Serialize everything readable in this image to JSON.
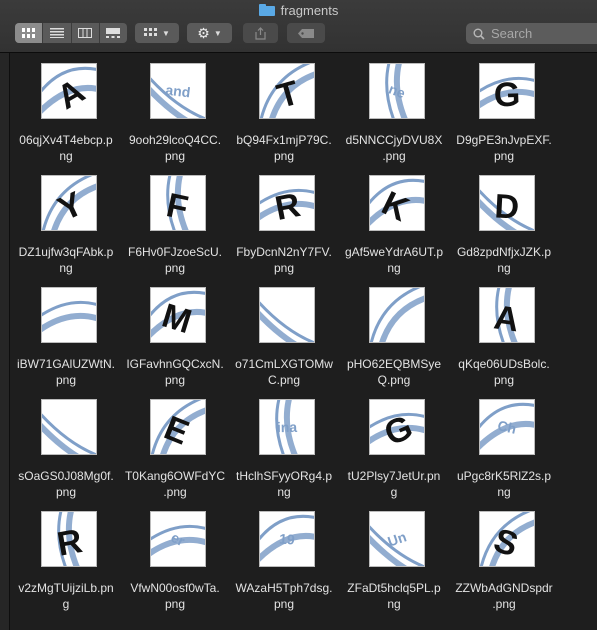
{
  "window": {
    "title": "fragments"
  },
  "toolbar": {
    "view_icons": [
      "icon-view-icon",
      "list-view-icon",
      "column-view-icon",
      "gallery-view-icon"
    ],
    "search_placeholder": "Search"
  },
  "files": [
    {
      "line1": "06qjXv4T4ebcp.p",
      "line2": "ng",
      "glyph": "A"
    },
    {
      "line1": "9ooh29lcoQ4CC.",
      "line2": "png",
      "glyph": "and"
    },
    {
      "line1": "bQ94Fx1mjP79C.",
      "line2": "png",
      "glyph": "T"
    },
    {
      "line1": "d5NNCCjyDVU8X",
      "line2": ".png",
      "glyph": "ne"
    },
    {
      "line1": "D9gPE3nJvpEXF.",
      "line2": "png",
      "glyph": "G"
    },
    {
      "line1": "DZ1ujfw3qFAbk.p",
      "line2": "ng",
      "glyph": "Y"
    },
    {
      "line1": "F6Hv0FJzoeScU.",
      "line2": "png",
      "glyph": "F"
    },
    {
      "line1": "FbyDcnN2nY7FV.",
      "line2": "png",
      "glyph": "R"
    },
    {
      "line1": "gAf5weYdrA6UT.p",
      "line2": "ng",
      "glyph": "K"
    },
    {
      "line1": "Gd8zpdNfjxJZK.p",
      "line2": "ng",
      "glyph": "D"
    },
    {
      "line1": "iBW71GAlUZWtN.",
      "line2": "png",
      "glyph": ""
    },
    {
      "line1": "IGFavhnGQCxcN.",
      "line2": "png",
      "glyph": "M"
    },
    {
      "line1": "o71CmLXGTOMw",
      "line2": "C.png",
      "glyph": ""
    },
    {
      "line1": "pHO62EQBMSye",
      "line2": "Q.png",
      "glyph": ""
    },
    {
      "line1": "qKqe06UDsBolc.",
      "line2": "png",
      "glyph": "A"
    },
    {
      "line1": "sOaGS0J08Mg0f.",
      "line2": "png",
      "glyph": ""
    },
    {
      "line1": "T0Kang6OWFdYC",
      "line2": ".png",
      "glyph": "E"
    },
    {
      "line1": "tHclhSFyyORg4.p",
      "line2": "ng",
      "glyph": "ina"
    },
    {
      "line1": "tU2Plsy7JetUr.pn",
      "line2": "g",
      "glyph": "G"
    },
    {
      "line1": "uPgc8rK5RlZ2s.p",
      "line2": "ng",
      "glyph": "Ch"
    },
    {
      "line1": "v2zMgTUijziLb.pn",
      "line2": "g",
      "glyph": "R"
    },
    {
      "line1": "VfwN00osf0wTa.",
      "line2": "png",
      "glyph": "er"
    },
    {
      "line1": "WAzaH5Tph7dsg.",
      "line2": "png",
      "glyph": "19"
    },
    {
      "line1": "ZFaDt5hclq5PL.p",
      "line2": "ng",
      "glyph": "Un"
    },
    {
      "line1": "ZZWbAdGNDspdr",
      "line2": ".png",
      "glyph": "S"
    }
  ],
  "colors": {
    "accent_blue": "#7f9fc8",
    "ink": "#111111"
  }
}
